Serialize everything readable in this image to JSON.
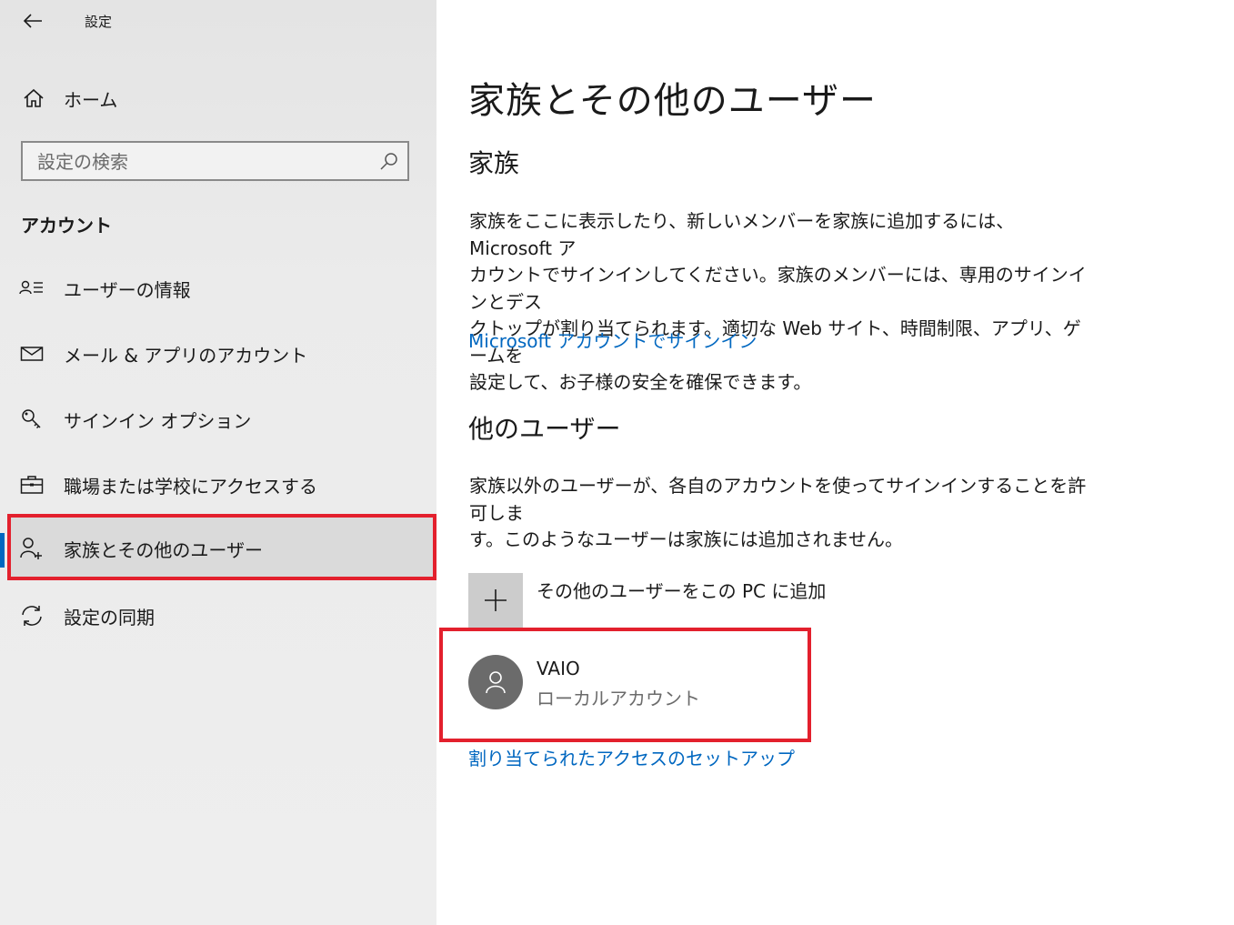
{
  "app": {
    "title": "設定"
  },
  "sidebar": {
    "home_label": "ホーム",
    "search_placeholder": "設定の検索",
    "section_heading": "アカウント",
    "items": [
      {
        "label": "ユーザーの情報",
        "icon": "user-info-icon"
      },
      {
        "label": "メール & アプリのアカウント",
        "icon": "mail-icon"
      },
      {
        "label": "サインイン オプション",
        "icon": "key-icon"
      },
      {
        "label": "職場または学校にアクセスする",
        "icon": "briefcase-icon"
      },
      {
        "label": "家族とその他のユーザー",
        "icon": "person-add-icon",
        "selected": true
      },
      {
        "label": "設定の同期",
        "icon": "sync-icon"
      }
    ]
  },
  "main": {
    "title": "家族とその他のユーザー",
    "family": {
      "heading": "家族",
      "description_lines": [
        "家族をここに表示したり、新しいメンバーを家族に追加するには、Microsoft ア",
        "カウントでサインインしてください。家族のメンバーには、専用のサインインとデス",
        "クトップが割り当てられます。適切な Web サイト、時間制限、アプリ、ゲームを",
        "設定して、お子様の安全を確保できます。"
      ],
      "signin_link": "Microsoft アカウントでサインイン"
    },
    "other_users": {
      "heading": "他のユーザー",
      "description_lines": [
        "家族以外のユーザーが、各自のアカウントを使ってサインインすることを許可しま",
        "す。このようなユーザーは家族には追加されません。"
      ],
      "add_label": "その他のユーザーをこの PC に追加",
      "user": {
        "name": "VAIO",
        "type": "ローカルアカウント"
      },
      "assigned_access_link": "割り当てられたアクセスのセットアップ"
    }
  },
  "colors": {
    "accent": "#0067c0",
    "highlight": "#e3202d",
    "sidebar_bg": "#eeeeee"
  }
}
